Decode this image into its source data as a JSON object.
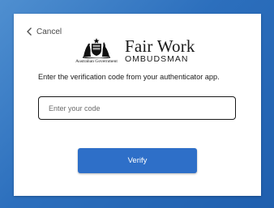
{
  "nav": {
    "cancel_label": "Cancel",
    "back_icon": "chevron-left-icon"
  },
  "branding": {
    "gov_label": "Australian Government",
    "title": "Fair Work",
    "subtitle": "OMBUDSMAN",
    "crest_icon": "coat-of-arms-icon"
  },
  "form": {
    "instruction": "Enter the verification code from your authenticator app.",
    "code_placeholder": "Enter your code",
    "code_value": "",
    "verify_label": "Verify"
  },
  "colors": {
    "accent": "#2e6fc8",
    "background": "#2c6fbd"
  }
}
